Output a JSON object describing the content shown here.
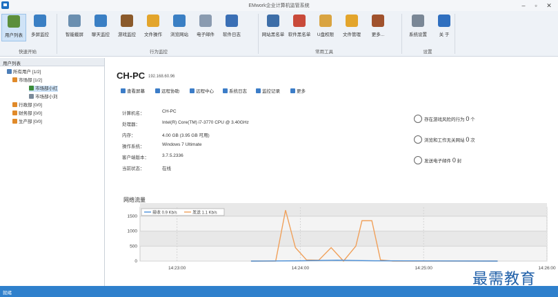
{
  "window": {
    "title": "EMwork企业计算机监管系统"
  },
  "ribbon": {
    "buttons": [
      {
        "label": "用户列表",
        "icon": "users-icon",
        "color": "#5c8f3c",
        "active": true
      },
      {
        "label": "多屏监控",
        "icon": "multi-screen-icon",
        "color": "#3a7fc4"
      },
      {
        "label": "智能截屏",
        "icon": "screenshot-icon",
        "color": "#6b8fb0"
      },
      {
        "label": "聊天监控",
        "icon": "chat-icon",
        "color": "#3a7fc4"
      },
      {
        "label": "游戏监控",
        "icon": "game-icon",
        "color": "#8b5a2b"
      },
      {
        "label": "文件操作",
        "icon": "folder-icon",
        "color": "#e3a52c"
      },
      {
        "label": "浏览网站",
        "icon": "compass-icon",
        "color": "#3a7fc4"
      },
      {
        "label": "电子邮件",
        "icon": "mail-icon",
        "color": "#8a9bb0"
      },
      {
        "label": "软件日志",
        "icon": "log-icon",
        "color": "#3a6fb5"
      },
      {
        "label": "网站黑名单",
        "icon": "globe-icon",
        "color": "#3d6ea8"
      },
      {
        "label": "软件黑名单",
        "icon": "app-block-icon",
        "color": "#c94a3a"
      },
      {
        "label": "U盘权限",
        "icon": "usb-icon",
        "color": "#d9a441"
      },
      {
        "label": "文件管理",
        "icon": "file-manage-icon",
        "color": "#e3a52c"
      },
      {
        "label": "更多...",
        "icon": "briefcase-icon",
        "color": "#a0522d"
      },
      {
        "label": "系统设置",
        "icon": "gear-icon",
        "color": "#7a8796"
      },
      {
        "label": "关 于",
        "icon": "info-icon",
        "color": "#2f6fbf"
      }
    ],
    "groups": [
      "快速开始",
      "行为监控",
      "常用工具",
      "设置"
    ]
  },
  "left_pane": {
    "header": "用户列表",
    "tree": [
      {
        "label": "所有用户  [1/2]",
        "icon": "computer-group-icon"
      },
      {
        "label": "市场部  [1/2]",
        "icon": "department-icon"
      },
      {
        "label": "市场部小红",
        "icon": "user-online-icon"
      },
      {
        "label": "市场部小刘",
        "icon": "user-offline-icon"
      },
      {
        "label": "行政部  [0/0]",
        "icon": "department-icon"
      },
      {
        "label": "财务部  [0/0]",
        "icon": "department-icon"
      },
      {
        "label": "生产部  [0/0]",
        "icon": "department-icon"
      }
    ]
  },
  "main": {
    "pc_name": "CH-PC",
    "ip": "192.168.60.96",
    "actions": [
      {
        "label": "查看屏幕",
        "icon": "monitor-icon"
      },
      {
        "label": "远程协助",
        "icon": "remote-icon"
      },
      {
        "label": "远程中心",
        "icon": "remote-center-icon"
      },
      {
        "label": "系统日志",
        "icon": "syslog-icon"
      },
      {
        "label": "监控记录",
        "icon": "search-icon"
      },
      {
        "label": "更多",
        "icon": "list-icon"
      }
    ],
    "info": [
      {
        "k": "计算机名：",
        "v": "CH-PC"
      },
      {
        "k": "处理器：",
        "v": "Intel(R) Core(TM) i7-3770 CPU @ 3.40GHz"
      },
      {
        "k": "内存：",
        "v": "4.00 GB (3.95 GB 可用)"
      },
      {
        "k": "操作系统：",
        "v": "Windows 7 Ultimate"
      },
      {
        "k": "客户端版本：",
        "v": "3.7.5.2336"
      },
      {
        "k": "当前状态：",
        "v": "在线"
      }
    ],
    "risks": [
      {
        "pre": "存在游戏风险的行为",
        "n": "0",
        "post": "个",
        "icon": "lock-icon"
      },
      {
        "pre": "浏览和工作无关网站",
        "n": "0",
        "post": "次",
        "icon": "compass-icon"
      },
      {
        "pre": "发送电子邮件",
        "n": "0",
        "post": "封",
        "icon": "envelope-icon"
      }
    ],
    "traffic_title": "网络流量"
  },
  "chart_data": {
    "type": "line",
    "legend": [
      "接收 0.9 Kb/s",
      "发送 1.1 Kb/s"
    ],
    "x_ticks": [
      "14:23:00",
      "14:24:00",
      "14:25:00",
      "14:26:00"
    ],
    "y_ticks": [
      0,
      500,
      1000,
      1500
    ],
    "ylim": [
      0,
      1800
    ],
    "series": [
      {
        "name": "发送 1.1 Kb/s",
        "color": "#f0a05a",
        "points": [
          [
            1.6,
            0
          ],
          [
            1.8,
            0
          ],
          [
            1.88,
            1700
          ],
          [
            1.96,
            450
          ],
          [
            2.05,
            40
          ],
          [
            2.15,
            30
          ],
          [
            2.25,
            450
          ],
          [
            2.35,
            0
          ],
          [
            2.45,
            500
          ],
          [
            2.5,
            1350
          ],
          [
            2.58,
            1350
          ],
          [
            2.65,
            40
          ],
          [
            2.75,
            0
          ],
          [
            3.6,
            0
          ]
        ]
      },
      {
        "name": "接收 0.9 Kb/s",
        "color": "#4a8fd8",
        "points": [
          [
            1.6,
            0
          ],
          [
            2.0,
            10
          ],
          [
            2.3,
            30
          ],
          [
            2.6,
            10
          ],
          [
            3.6,
            0
          ]
        ]
      }
    ]
  },
  "statusbar": {
    "text": "就绪"
  },
  "watermark": "最需教育"
}
